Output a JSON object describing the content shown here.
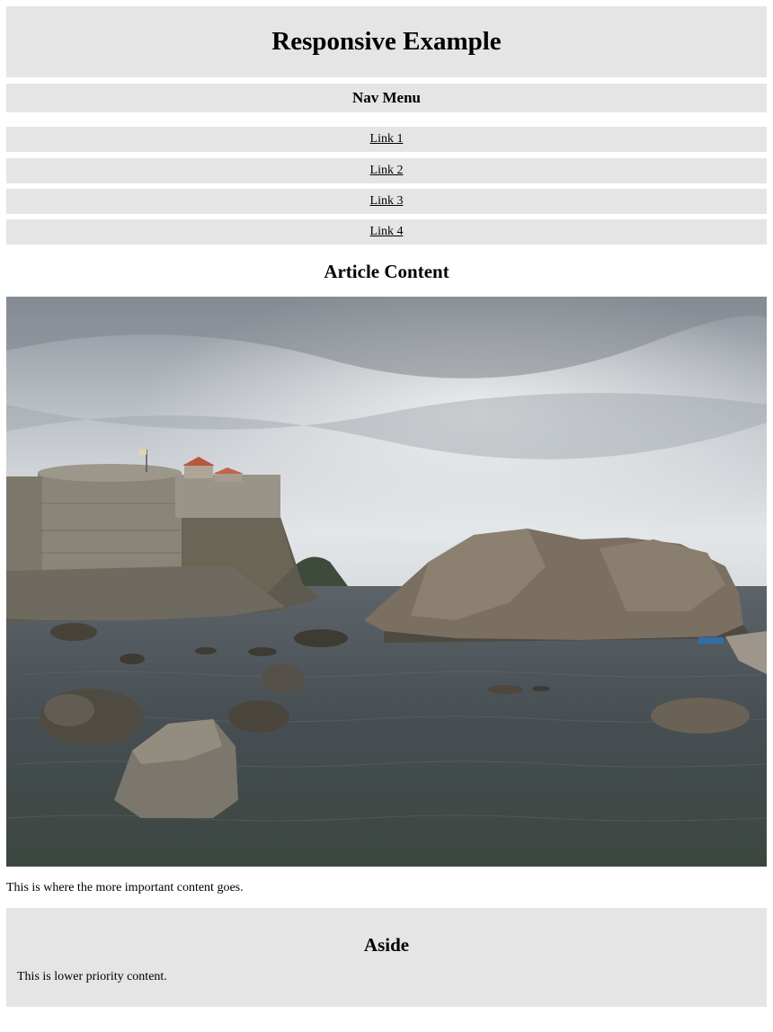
{
  "header": {
    "title": "Responsive Example"
  },
  "nav": {
    "heading": "Nav Menu",
    "links": [
      {
        "label": "Link 1"
      },
      {
        "label": "Link 2"
      },
      {
        "label": "Link 3"
      },
      {
        "label": "Link 4"
      }
    ]
  },
  "article": {
    "title": "Article Content",
    "image_alt": "Rocky coastline with a stone fortress under a cloudy sky",
    "text": "This is where the more important content goes."
  },
  "aside": {
    "title": "Aside",
    "text": "This is lower priority content."
  },
  "colors": {
    "panel_background": "#e5e5e5",
    "page_background": "#ffffff",
    "text": "#000000"
  }
}
